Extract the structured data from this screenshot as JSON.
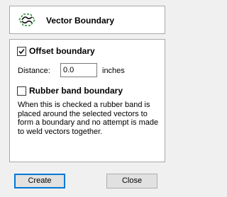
{
  "header": {
    "title": "Vector Boundary",
    "icon": "vector-boundary-icon"
  },
  "options": {
    "offset_boundary": {
      "label": "Offset boundary",
      "checked": true
    },
    "distance": {
      "label": "Distance:",
      "value": "0.0",
      "units": "inches"
    },
    "rubber_band_boundary": {
      "label": "Rubber band boundary",
      "checked": false
    },
    "description": "When this is checked a rubber band is placed around the selected vectors to form a boundary and no attempt is made to weld vectors together."
  },
  "buttons": {
    "create": "Create",
    "close": "Close"
  },
  "colors": {
    "icon_accent": "#2a8a3a",
    "default_button_border": "#0078d7"
  }
}
